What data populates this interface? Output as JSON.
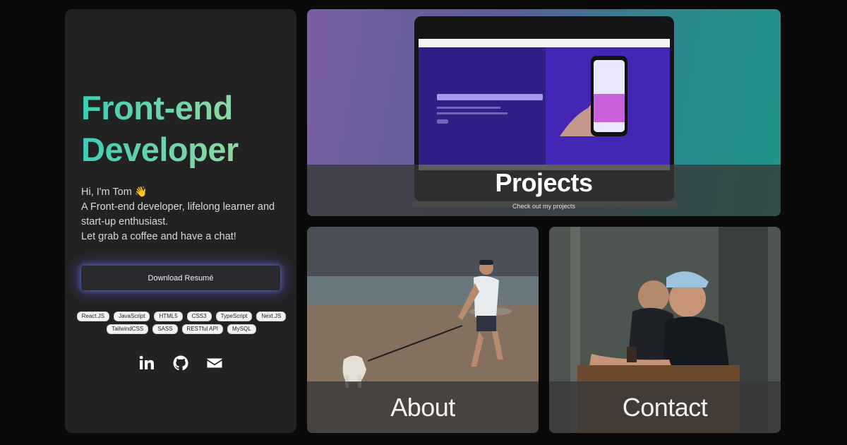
{
  "intro": {
    "title_line1": "Front-end",
    "title_line2": "Developer",
    "bio": [
      "Hi, I'm Tom 👋",
      "A Front-end developer, lifelong learner and",
      "start-up enthusiast.",
      "Let grab a coffee and have a chat!"
    ],
    "resume_button": "Download Resumé",
    "skills": [
      "React.JS",
      "JavaScript",
      "HTML5",
      "CSS3",
      "TypeScript",
      "Next.JS",
      "TailwindCSS",
      "SASS",
      "RESTful API",
      "MySQL"
    ],
    "socials": [
      {
        "name": "linkedin-icon"
      },
      {
        "name": "github-icon"
      },
      {
        "name": "mail-icon"
      }
    ]
  },
  "tiles": {
    "projects": {
      "title": "Projects",
      "subtitle": "Check out my projects"
    },
    "about": {
      "title": "About"
    },
    "contact": {
      "title": "Contact"
    }
  },
  "colors": {
    "background": "#0a0a0a",
    "card": "#222222",
    "title_gradient_start": "#3ecdb8",
    "title_gradient_end": "#a6dc9a",
    "button_glow": "#6e5ae6"
  }
}
